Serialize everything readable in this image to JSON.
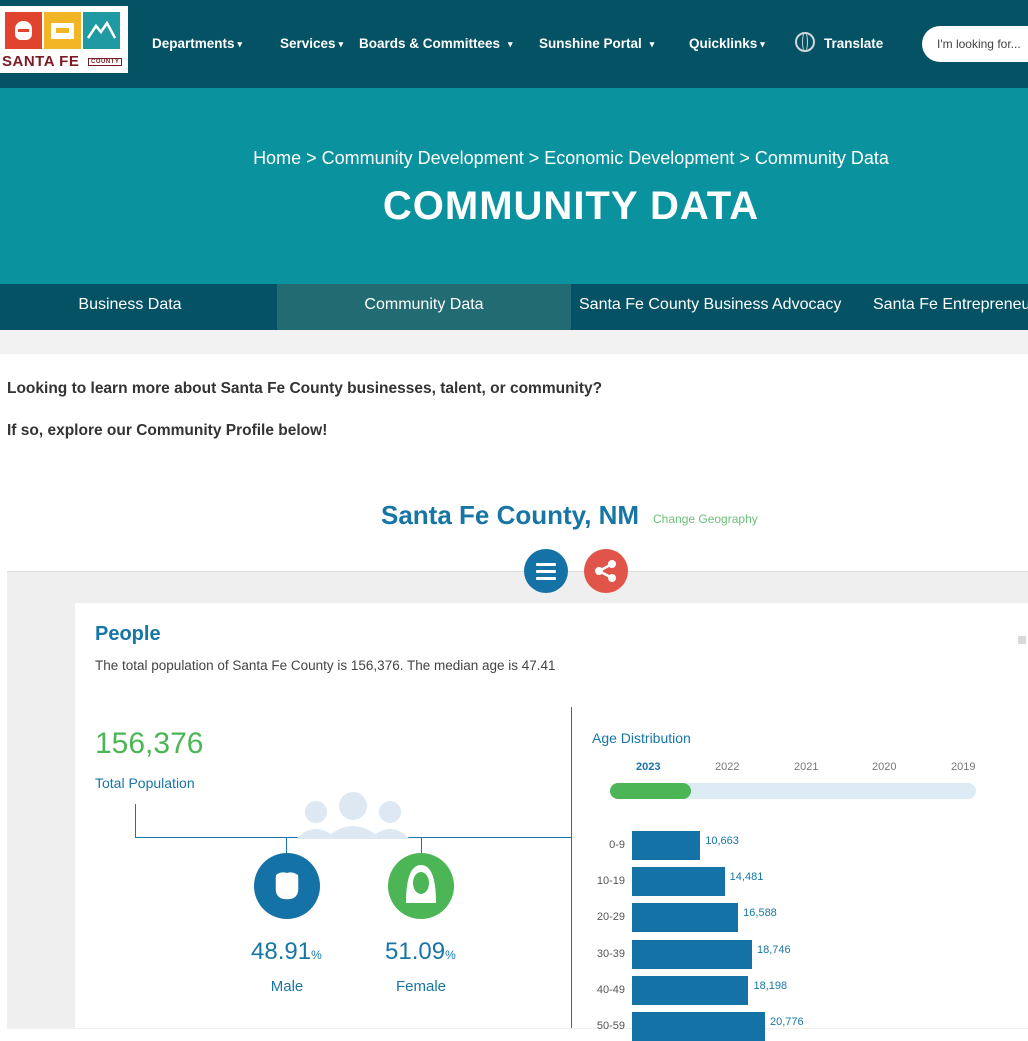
{
  "header": {
    "logo": {
      "brand": "SANTA FE",
      "brand_sub": "COUNTY"
    },
    "nav": [
      {
        "label": "Departments",
        "caret": true
      },
      {
        "label": "Services",
        "caret": true
      },
      {
        "label": "Boards & Committees",
        "caret": true
      },
      {
        "label": "Sunshine Portal",
        "caret": true
      },
      {
        "label": "Quicklinks",
        "caret": true
      }
    ],
    "translate_label": "Translate",
    "search_placeholder": "I'm looking for..."
  },
  "hero": {
    "breadcrumb": [
      "Home",
      "Community Development",
      "Economic Development",
      "Community Data"
    ],
    "separator": ">",
    "title": "COMMUNITY DATA"
  },
  "tabs": [
    {
      "label": "Business Data",
      "active": false
    },
    {
      "label": "Community Data",
      "active": true
    },
    {
      "label": "Santa Fe County Business Advocacy",
      "active": false
    },
    {
      "label": "Santa Fe Entrepreneurship",
      "active": false
    }
  ],
  "intro": {
    "line1": "Looking to learn more about Santa Fe County businesses, talent, or community?",
    "line2": "If so, explore our Community Profile below!"
  },
  "geography": {
    "title": "Santa Fe County, NM",
    "change_link": "Change Geography"
  },
  "people": {
    "title": "People",
    "summary": "The total population of Santa Fe County is 156,376. The median age is 47.41",
    "total_population": "156,376",
    "total_label": "Total Population",
    "male": {
      "pct": "48.91",
      "label": "Male"
    },
    "female": {
      "pct": "51.09",
      "label": "Female"
    },
    "pct_symbol": "%"
  },
  "colors": {
    "header": "#045264",
    "hero": "#0a939f",
    "accent_blue": "#1572a6",
    "accent_green": "#4cb556",
    "share_red": "#e05449"
  },
  "chart_data": {
    "type": "bar",
    "title": "Age Distribution",
    "years": [
      "2023",
      "2022",
      "2021",
      "2020",
      "2019"
    ],
    "selected_year": "2023",
    "slider_position": 0.22,
    "categories": [
      "0-9",
      "10-19",
      "20-29",
      "30-39",
      "40-49",
      "50-59"
    ],
    "values": [
      10663,
      14481,
      16588,
      18746,
      18198,
      20776
    ],
    "value_labels": [
      "10,663",
      "14,481",
      "16,588",
      "18,746",
      "18,198",
      "20,776"
    ]
  }
}
